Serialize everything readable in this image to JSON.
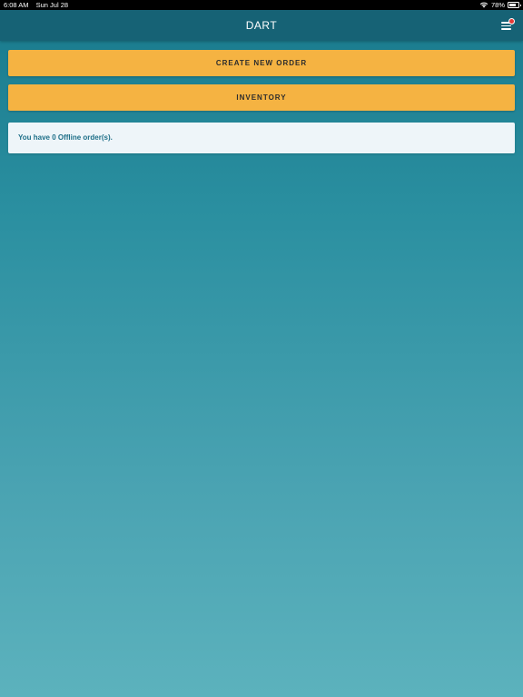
{
  "status_bar": {
    "time": "6:08 AM",
    "date": "Sun Jul 28",
    "battery_percent": "78%",
    "battery_level": 0.78
  },
  "header": {
    "title": "DART",
    "menu_icon": "hamburger-menu-icon",
    "notification_color": "#e53935"
  },
  "actions": {
    "create_new_order": "CREATE NEW ORDER",
    "inventory": "INVENTORY"
  },
  "offline_notice": {
    "text": "You have 0 Offline order(s)."
  },
  "colors": {
    "header_bg": "#166275",
    "button_bg": "#f5b342",
    "card_bg": "#eef5f9",
    "card_text": "#1e6f88"
  }
}
